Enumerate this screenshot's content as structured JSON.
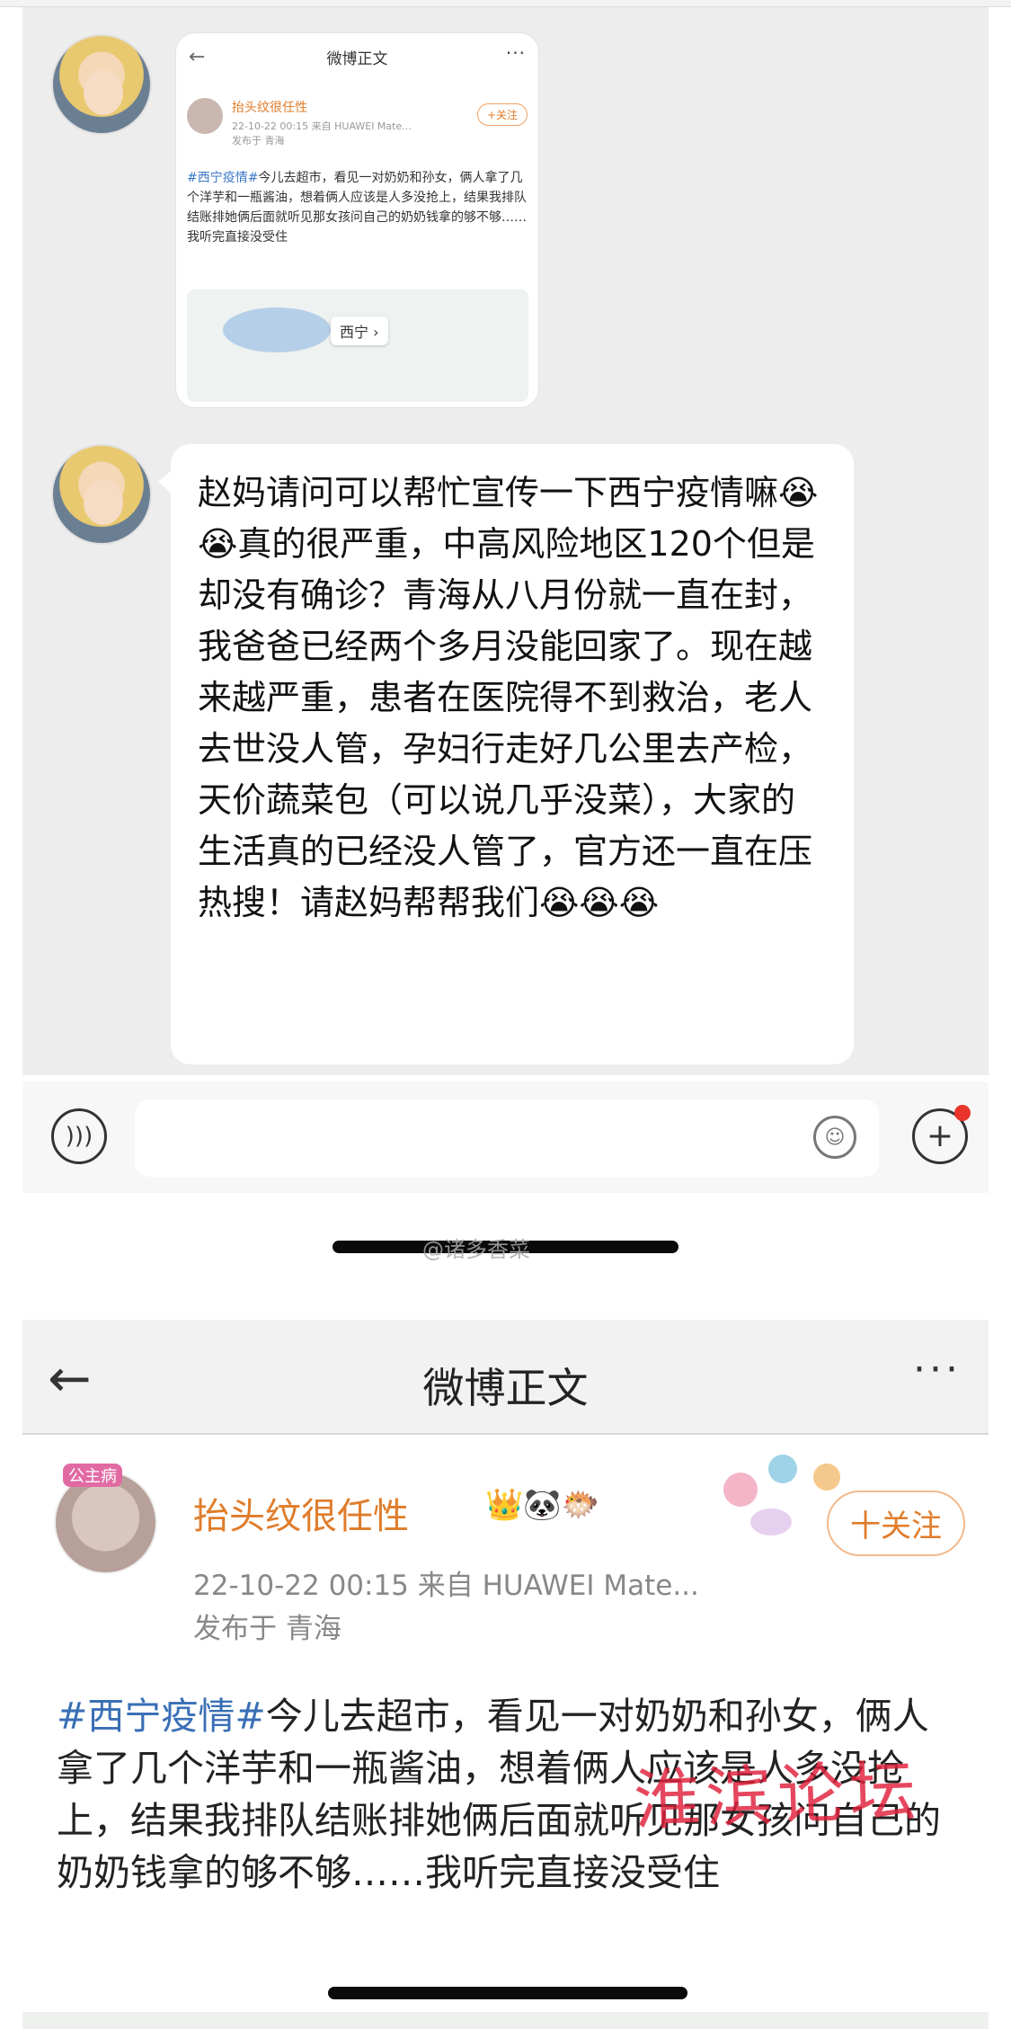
{
  "chat": {
    "shared_card": {
      "header_title": "微博正文",
      "back_icon": "back-arrow-icon",
      "more_label": "···",
      "author": "抬头纹很任性",
      "meta": "22-10-22 00:15  来自 HUAWEI Mate...",
      "location": "发布于 青海",
      "follow_label": "+关注",
      "hashtag": "#西宁疫情#",
      "body": "今儿去超市，看见一对奶奶和孙女，俩人拿了几个洋芋和一瓶酱油，想着俩人应该是人多没抢上，结果我排队结账排她俩后面就听见那女孩问自己的奶奶钱拿的够不够……我听完直接没受住",
      "map_label": "西宁 ›"
    },
    "message": "赵妈请问可以帮忙宣传一下西宁疫情嘛😭😭真的很严重，中高风险地区120个但是却没有确诊？青海从八月份就一直在封，我爸爸已经两个多月没能回家了。现在越来越严重，患者在医院得不到救治，老人去世没人管，孕妇行走好几公里去产检，天价蔬菜包（可以说几乎没菜），大家的生活真的已经没人管了，官方还一直在压热搜！请赵妈帮帮我们😭😭😭",
    "input": {
      "voice_icon": "voice-icon",
      "emoji_icon": "emoji-icon",
      "plus_icon": "plus-icon",
      "value": ""
    }
  },
  "watermark_top": "@诸多香菜",
  "weibo": {
    "header_title": "微博正文",
    "back_label": "←",
    "more_label": "···",
    "avatar_tag": "公主病",
    "author": "抬头纹很任性",
    "badges": "👑🐼🐡",
    "meta": "22-10-22 00:15  来自 HUAWEI Mate...",
    "location": "发布于 青海",
    "follow_label": "十关注",
    "hashtag": "#西宁疫情#",
    "body": "今儿去超市，看见一对奶奶和孙女，俩人拿了几个洋芋和一瓶酱油，想着俩人应该是人多没抢上，结果我排队结账排她俩后面就听见那女孩问自己的奶奶钱拿的够不够……我听完直接没受住",
    "watermark": "淮滨论坛"
  },
  "colors": {
    "author_orange": "#e07c2a",
    "hashtag_blue": "#3a6fb5",
    "chat_background": "#ededed",
    "notification_red": "#e8342a",
    "watermark_red": "#e0213b"
  }
}
